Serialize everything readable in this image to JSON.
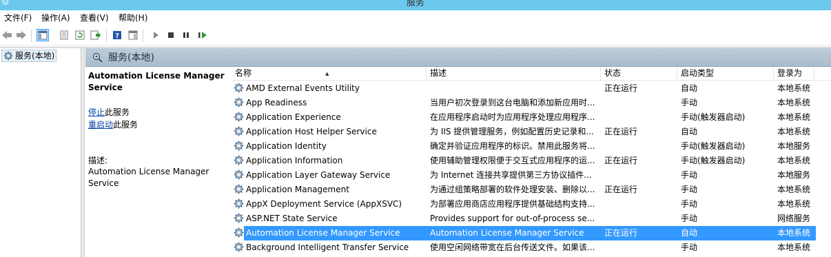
{
  "window": {
    "title": "服务"
  },
  "menu": [
    {
      "label": "文件(F)"
    },
    {
      "label": "操作(A)"
    },
    {
      "label": "查看(V)"
    },
    {
      "label": "帮助(H)"
    }
  ],
  "toolbar": {
    "buttons": [
      "back-icon",
      "forward-icon",
      "show-hide-tree-icon",
      "properties-icon",
      "refresh-icon",
      "export-list-icon",
      "help-icon",
      "show-hide-action-pane-icon",
      "start-service-icon",
      "stop-service-icon",
      "pause-service-icon",
      "restart-service-icon"
    ]
  },
  "tree": {
    "root_label": "服务(本地)"
  },
  "header": {
    "title": "服务(本地)"
  },
  "detail": {
    "service_name": "Automation License Manager Service",
    "stop_link": "停止",
    "stop_suffix": "此服务",
    "restart_link": "重启动",
    "restart_suffix": "此服务",
    "desc_label": "描述:",
    "desc_text": "Automation License Manager Service"
  },
  "columns": {
    "name": "名称",
    "desc": "描述",
    "status": "状态",
    "startup": "启动类型",
    "logon": "登录为"
  },
  "services": [
    {
      "name": "AMD External Events Utility",
      "desc": "",
      "status": "正在运行",
      "startup": "自动",
      "logon": "本地系统"
    },
    {
      "name": "App Readiness",
      "desc": "当用户初次登录到这台电脑和添加新应用时...",
      "status": "",
      "startup": "手动",
      "logon": "本地系统"
    },
    {
      "name": "Application Experience",
      "desc": "在应用程序启动时为应用程序处理应用程序...",
      "status": "",
      "startup": "手动(触发器启动)",
      "logon": "本地系统"
    },
    {
      "name": "Application Host Helper Service",
      "desc": "为 IIS 提供管理服务，例如配置历史记录和...",
      "status": "正在运行",
      "startup": "自动",
      "logon": "本地系统"
    },
    {
      "name": "Application Identity",
      "desc": "确定并验证应用程序的标识。禁用此服务将...",
      "status": "",
      "startup": "手动(触发器启动)",
      "logon": "本地服务"
    },
    {
      "name": "Application Information",
      "desc": "使用辅助管理权限便于交互式应用程序的运...",
      "status": "正在运行",
      "startup": "手动(触发器启动)",
      "logon": "本地系统"
    },
    {
      "name": "Application Layer Gateway Service",
      "desc": "为 Internet 连接共享提供第三方协议插件...",
      "status": "",
      "startup": "手动",
      "logon": "本地服务"
    },
    {
      "name": "Application Management",
      "desc": "为通过组策略部署的软件处理安装、删除以...",
      "status": "正在运行",
      "startup": "手动",
      "logon": "本地系统"
    },
    {
      "name": "AppX Deployment Service (AppXSVC)",
      "desc": "为部署应用商店应用程序提供基础结构支持...",
      "status": "",
      "startup": "手动",
      "logon": "本地系统"
    },
    {
      "name": "ASP.NET State Service",
      "desc": "Provides support for out-of-process se...",
      "status": "",
      "startup": "手动",
      "logon": "网络服务"
    },
    {
      "name": "Automation License Manager Service",
      "desc": "Automation License Manager Service",
      "status": "正在运行",
      "startup": "自动",
      "logon": "本地系统",
      "selected": true
    },
    {
      "name": "Background Intelligent Transfer Service",
      "desc": "使用空闲网络带宽在后台传送文件。如果该...",
      "status": "",
      "startup": "手动",
      "logon": "本地系统"
    }
  ]
}
